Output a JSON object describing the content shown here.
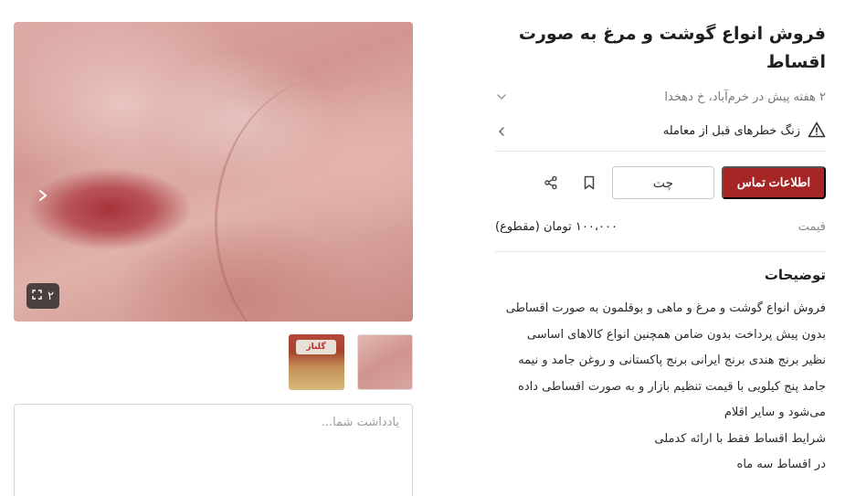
{
  "listing": {
    "title": "فروش انواع گوشت و مرغ به صورت اقساط",
    "meta": "۲ هفته پیش در خرم‌آباد، خ دهخدا",
    "risk_text": "زنگ خطرهای قبل از معامله"
  },
  "actions": {
    "contact_label": "اطلاعات تماس",
    "chat_label": "چت"
  },
  "price": {
    "label": "قیمت",
    "value": "۱۰۰،۰۰۰ تومان (مقطوع)"
  },
  "description": {
    "heading": "توضیحات",
    "lines": [
      "فروش انواع گوشت و مرغ و ماهی و بوقلمون به صورت اقساطی",
      "بدون پیش پرداخت بدون ضامن همچنین انواع کالاهای اساسی",
      "نظیر برنج هندی برنج ایرانی برنج پاکستانی و روغن جامد و نیمه",
      "جامد پنج کیلویی با قیمت تنظیم بازار و به صورت اقساطی داده",
      "می‌شود و سایر اقلام",
      "شرایط اقساط فقط با ارائه کدملی",
      "در اقساط سه ماه"
    ]
  },
  "gallery": {
    "counter": "۲",
    "thumb_logo_text": "گلناز"
  },
  "note": {
    "placeholder": "یادداشت شما..."
  },
  "colors": {
    "accent": "#a62626",
    "muted_text": "#777777"
  },
  "icons": {
    "meta_toggle": "chevron-down-icon",
    "risk": "warning-triangle-icon",
    "risk_arrow": "chevron-left-icon",
    "bookmark": "bookmark-icon",
    "share": "share-icon",
    "gallery_next": "chevron-right-icon",
    "fullscreen": "fullscreen-icon"
  }
}
